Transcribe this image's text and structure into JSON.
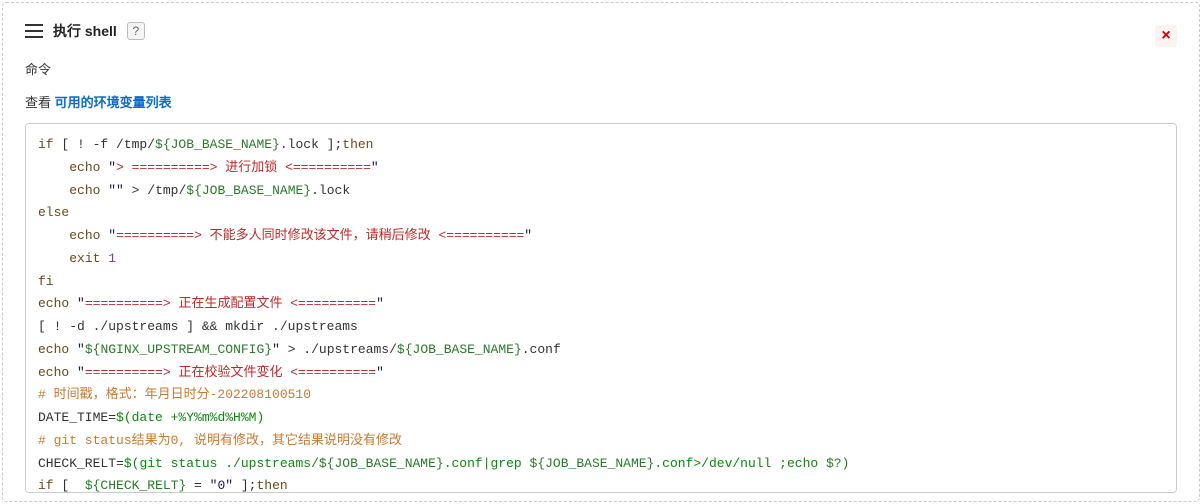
{
  "header": {
    "title": "执行 shell",
    "help": "?"
  },
  "close": "×",
  "labels": {
    "command": "命令",
    "see": "查看 ",
    "env_link": "可用的环境变量列表"
  },
  "code": {
    "lines": [
      [
        [
          "kw",
          "if"
        ],
        [
          "op",
          " [ ! -f /tmp/"
        ],
        [
          "var",
          "${JOB_BASE_NAME}"
        ],
        [
          "op",
          ".lock ];"
        ],
        [
          "kw",
          "then"
        ]
      ],
      [
        [
          "op",
          "    "
        ],
        [
          "kw",
          "echo"
        ],
        [
          "op",
          " "
        ],
        [
          "str",
          "\""
        ],
        [
          "red",
          "> ==========> 进行加锁 <=========="
        ],
        [
          "str",
          "\""
        ]
      ],
      [
        [
          "op",
          "    "
        ],
        [
          "kw",
          "echo"
        ],
        [
          "op",
          " "
        ],
        [
          "str",
          "\"\""
        ],
        [
          "op",
          " > /tmp/"
        ],
        [
          "var",
          "${JOB_BASE_NAME}"
        ],
        [
          "op",
          ".lock"
        ]
      ],
      [
        [
          "kw",
          "else"
        ]
      ],
      [
        [
          "op",
          "    "
        ],
        [
          "kw",
          "echo"
        ],
        [
          "op",
          " "
        ],
        [
          "str",
          "\""
        ],
        [
          "red",
          "==========> 不能多人同时修改该文件，请稍后修改 <=========="
        ],
        [
          "str",
          "\""
        ]
      ],
      [
        [
          "op",
          "    "
        ],
        [
          "kw",
          "exit"
        ],
        [
          "op",
          " "
        ],
        [
          "num",
          "1"
        ]
      ],
      [
        [
          "kw",
          "fi"
        ]
      ],
      [
        [
          "kw",
          "echo"
        ],
        [
          "op",
          " "
        ],
        [
          "str",
          "\""
        ],
        [
          "red",
          "==========> 正在生成配置文件 <=========="
        ],
        [
          "str",
          "\""
        ]
      ],
      [
        [
          "op",
          "[ ! -d ./upstreams ] && mkdir ./upstreams"
        ]
      ],
      [
        [
          "kw",
          "echo"
        ],
        [
          "op",
          " "
        ],
        [
          "str",
          "\""
        ],
        [
          "var",
          "${NGINX_UPSTREAM_CONFIG}"
        ],
        [
          "str",
          "\""
        ],
        [
          "op",
          " > ./upstreams/"
        ],
        [
          "var",
          "${JOB_BASE_NAME}"
        ],
        [
          "op",
          ".conf"
        ]
      ],
      [
        [
          "kw",
          "echo"
        ],
        [
          "op",
          " "
        ],
        [
          "str",
          "\""
        ],
        [
          "red",
          "==========> 正在校验文件变化 <=========="
        ],
        [
          "str",
          "\""
        ]
      ],
      [
        [
          "cmt",
          "# 时间戳，格式：年月日时分-202208100510"
        ]
      ],
      [
        [
          "op",
          "DATE_TIME="
        ],
        [
          "link",
          "$("
        ],
        [
          "link",
          "date +%Y%m%d%H%M"
        ],
        [
          "link",
          ")"
        ]
      ],
      [
        [
          "cmt",
          "# git status结果为0, 说明有修改，其它结果说明没有修改"
        ]
      ],
      [
        [
          "op",
          "CHECK_RELT="
        ],
        [
          "link",
          "$("
        ],
        [
          "link",
          "git status ./upstreams/"
        ],
        [
          "var",
          "${JOB_BASE_NAME}"
        ],
        [
          "link",
          ".conf|grep "
        ],
        [
          "var",
          "${JOB_BASE_NAME}"
        ],
        [
          "link",
          ".conf>/dev/null ;echo "
        ],
        [
          "var",
          "$?"
        ],
        [
          "link",
          ")"
        ]
      ],
      [
        [
          "kw",
          "if"
        ],
        [
          "op",
          " [  "
        ],
        [
          "var",
          "${CHECK_RELT}"
        ],
        [
          "op",
          " = "
        ],
        [
          "str",
          "\"0\""
        ],
        [
          "op",
          " ];"
        ],
        [
          "kw",
          "then"
        ]
      ]
    ]
  }
}
